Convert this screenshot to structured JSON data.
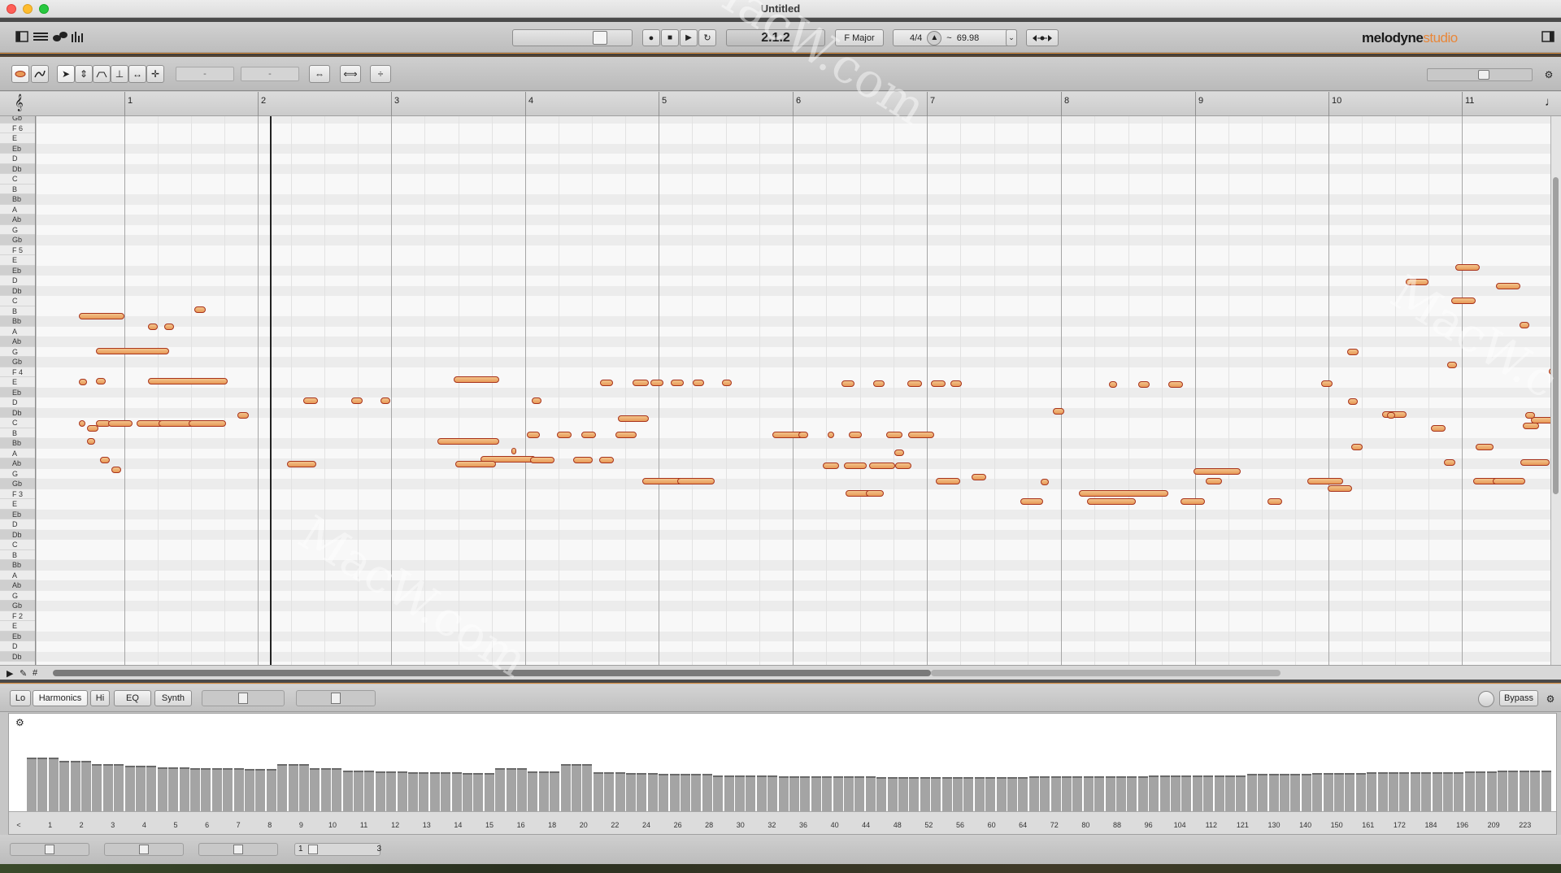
{
  "window": {
    "title": "Untitled"
  },
  "transport": {
    "position": "2.1.2",
    "key": "F Major",
    "time_signature": "4/4",
    "tempo": "69.98",
    "tempo_prefix": "~",
    "tempo_dropdown": "⌄"
  },
  "brand": {
    "name": "melodyne",
    "edition": "studio"
  },
  "tools": {
    "field1": "-",
    "field2": "-"
  },
  "ruler": {
    "bars": [
      "1",
      "2",
      "3",
      "4",
      "5",
      "6",
      "7",
      "8",
      "9",
      "10",
      "11"
    ]
  },
  "pitch_keys": [
    "Gb",
    "F 6",
    "E",
    "Eb",
    "D",
    "Db",
    "C",
    "B",
    "Bb",
    "A",
    "Ab",
    "G",
    "Gb",
    "F 5",
    "E",
    "Eb",
    "D",
    "Db",
    "C",
    "B",
    "Bb",
    "A",
    "Ab",
    "G",
    "Gb",
    "F 4",
    "E",
    "Eb",
    "D",
    "Db",
    "C",
    "B",
    "Bb",
    "A",
    "Ab",
    "G",
    "Gb",
    "F 3",
    "E",
    "Eb",
    "D",
    "Db",
    "C",
    "B",
    "Bb",
    "A",
    "Ab",
    "G",
    "Gb",
    "F 2",
    "E",
    "Eb",
    "D",
    "Db"
  ],
  "panel": {
    "tabs": [
      "Lo",
      "Harmonics",
      "Hi",
      "EQ",
      "Synth"
    ],
    "active_tab": "Harmonics",
    "bypass_label": "Bypass",
    "footer_left": "1",
    "footer_right": "3"
  },
  "spectrum": {
    "labels": [
      "<",
      "1",
      "2",
      "3",
      "4",
      "5",
      "6",
      "7",
      "8",
      "9",
      "10",
      "11",
      "12",
      "13",
      "14",
      "15",
      "16",
      "18",
      "20",
      "22",
      "24",
      "26",
      "28",
      "30",
      "32",
      "36",
      "40",
      "44",
      "48",
      "52",
      "56",
      "60",
      "64",
      "72",
      "80",
      "88",
      "96",
      "104",
      "112",
      "121",
      "130",
      "140",
      "150",
      "161",
      "172",
      "184",
      "196",
      "209",
      "223"
    ],
    "levels": [
      0.55,
      0.52,
      0.48,
      0.47,
      0.45,
      0.44,
      0.44,
      0.43,
      0.48,
      0.44,
      0.42,
      0.41,
      0.4,
      0.4,
      0.39,
      0.44,
      0.41,
      0.48,
      0.4,
      0.39,
      0.38,
      0.38,
      0.37,
      0.37,
      0.36,
      0.36,
      0.36,
      0.35,
      0.35,
      0.35,
      0.35,
      0.35,
      0.36,
      0.36,
      0.36,
      0.36,
      0.37,
      0.37,
      0.37,
      0.38,
      0.38,
      0.39,
      0.39,
      0.4,
      0.4,
      0.4,
      0.41,
      0.42,
      0.42
    ]
  },
  "icons": {
    "gear": "⚙",
    "record": "●",
    "stop": "■",
    "play": "▶",
    "loop": "↻"
  }
}
